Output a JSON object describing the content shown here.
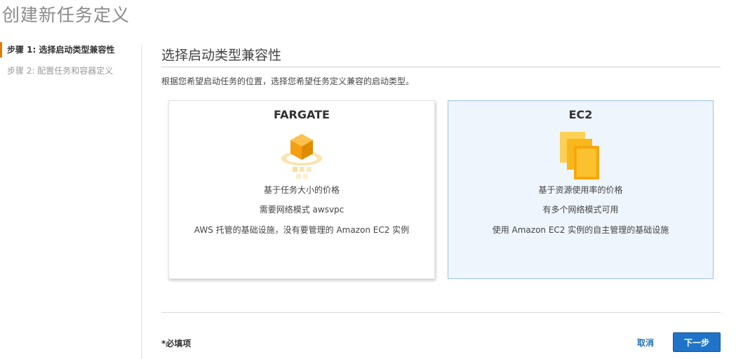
{
  "page": {
    "title": "创建新任务定义"
  },
  "sidebar": {
    "steps": [
      {
        "label": "步骤 1: 选择启动类型兼容性",
        "active": true
      },
      {
        "label": "步骤 2: 配置任务和容器定义",
        "active": false
      }
    ]
  },
  "main": {
    "section_title": "选择启动类型兼容性",
    "description": "根据您希望启动任务的位置，选择您希望任务定义兼容的启动类型。",
    "cards": [
      {
        "title": "FARGATE",
        "icon": "fargate-icon",
        "lines": [
          "基于任务大小的价格",
          "需要网络模式 awsvpc",
          "AWS 托管的基础设施，没有要管理的 Amazon EC2 实例"
        ],
        "selected": false
      },
      {
        "title": "EC2",
        "icon": "ec2-icon",
        "lines": [
          "基于资源使用率的价格",
          "有多个网络模式可用",
          "使用 Amazon EC2 实例的自主管理的基础设施"
        ],
        "selected": true
      }
    ]
  },
  "footer": {
    "required_note": "*必填项",
    "cancel_label": "取消",
    "next_label": "下一步"
  },
  "colors": {
    "accent": "#e07b00",
    "primary_button": "#1f74c9",
    "link": "#1f6fbf",
    "selected_card_bg": "#eef5fc",
    "selected_card_border": "#9fc3e1"
  }
}
